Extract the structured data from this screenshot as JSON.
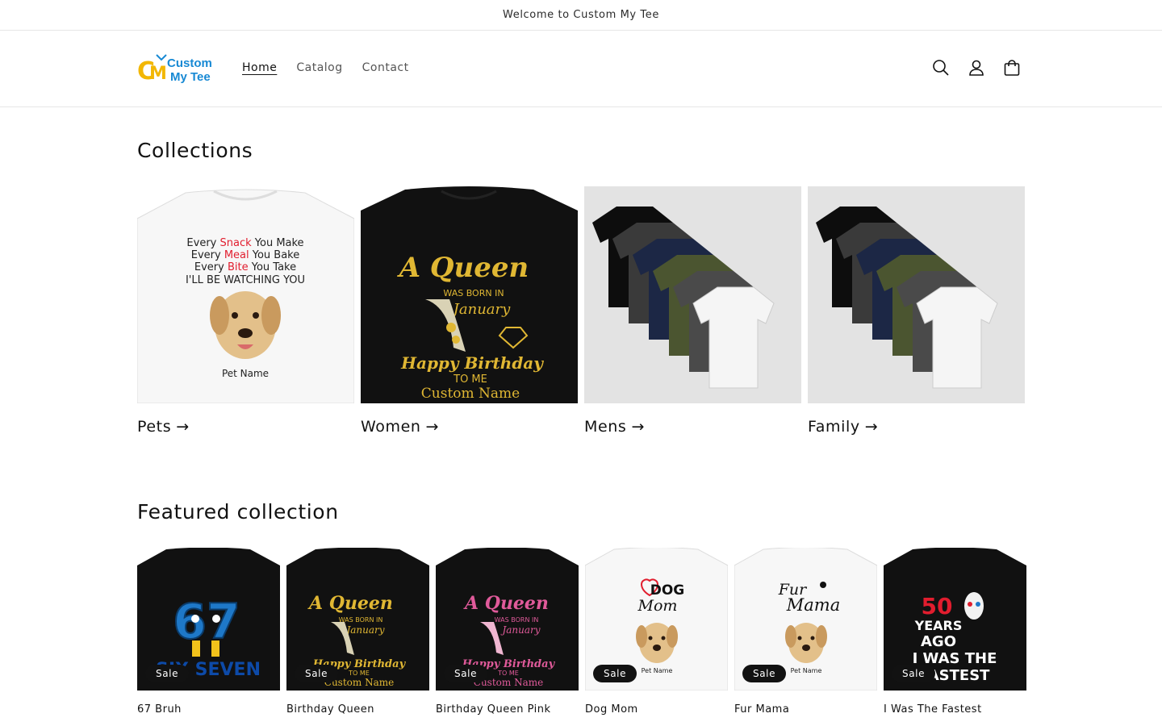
{
  "announcement": "Welcome to Custom My Tee",
  "logo": {
    "mark": "CMT",
    "line1": "Custom",
    "line2": "My Tee"
  },
  "nav": [
    {
      "label": "Home",
      "active": true
    },
    {
      "label": "Catalog",
      "active": false
    },
    {
      "label": "Contact",
      "active": false
    }
  ],
  "header_icons": [
    "search-icon",
    "account-icon",
    "cart-icon"
  ],
  "collections_title": "Collections",
  "collections": [
    {
      "label": "Pets",
      "shirt": "white",
      "bg": "#ffffff",
      "print": {
        "lines": [
          "Every ",
          "Snack",
          " You Make",
          "Every ",
          "Meal",
          " You Bake",
          "Every ",
          "Bite",
          " You Take",
          "I'LL BE WATCHING YOU"
        ],
        "caption": "Pet Name"
      }
    },
    {
      "label": "Women",
      "shirt": "black",
      "bg": "#ffffff",
      "print": {
        "l1": "A Queen",
        "l2": "WAS BORN IN",
        "l3": "January",
        "l4": "Happy Birthday",
        "l5": "TO ME",
        "l6": "Custom Name"
      }
    },
    {
      "label": "Mens",
      "shirt": "stack",
      "bg": "#e3e3e3"
    },
    {
      "label": "Family",
      "shirt": "stack",
      "bg": "#e3e3e3"
    }
  ],
  "featured_title": "Featured collection",
  "products": [
    {
      "title": "67 Bruh",
      "badge": "Sale",
      "shirt": "black",
      "print": {
        "big": "67",
        "small": "SIX SEVEN"
      }
    },
    {
      "title": "Birthday Queen",
      "badge": "Sale",
      "shirt": "black",
      "print": {
        "l1": "A Queen",
        "l2": "WAS BORN IN",
        "l3": "January",
        "l4": "Happy Birthday",
        "l5": "TO ME",
        "l6": "Custom Name"
      }
    },
    {
      "title": "Birthday Queen Pink",
      "badge": "Sale",
      "shirt": "black",
      "print": {
        "l1": "A Queen",
        "l2": "WAS BORN IN",
        "l3": "January",
        "l4": "Happy Birthday",
        "l5": "TO ME",
        "l6": "Custom Name"
      }
    },
    {
      "title": "Dog Mom",
      "badge": "Sale",
      "shirt": "white",
      "print": {
        "l1": "DOG",
        "l2": "Mom",
        "caption": "Pet Name"
      }
    },
    {
      "title": "Fur Mama",
      "badge": "Sale",
      "shirt": "white",
      "print": {
        "l1": "Fur",
        "l2": "Mama",
        "caption": "Pet Name"
      }
    },
    {
      "title": "I Was The Fastest",
      "badge": "Sale",
      "shirt": "black",
      "print": {
        "l1": "50",
        "l2": "YEARS",
        "l3": "AGO",
        "l4": "I WAS THE",
        "l5": "FASTEST"
      }
    }
  ],
  "colors": {
    "gold": "#e0b733",
    "pink": "#e05a9a",
    "red": "#e11d2e",
    "blue": "#1e78c8",
    "logo_yellow": "#f2b705",
    "logo_blue": "#1789d4"
  }
}
